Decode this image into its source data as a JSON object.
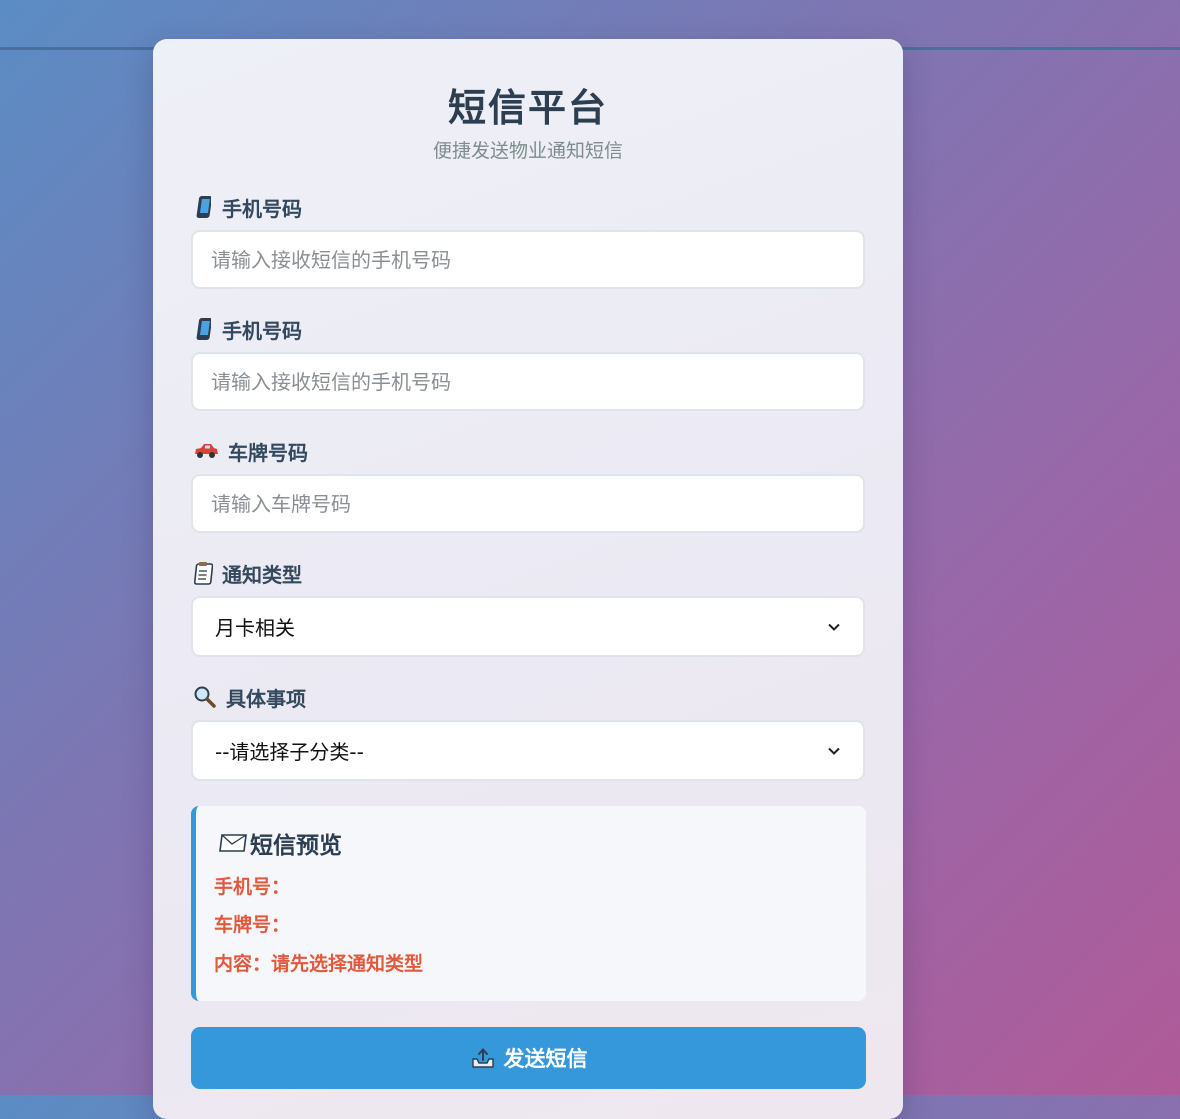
{
  "header": {
    "title": "短信平台",
    "subtitle": "便捷发送物业通知短信"
  },
  "form": {
    "phone1": {
      "label": "手机号码",
      "icon": "mobile-phone-icon",
      "placeholder": "请输入接收短信的手机号码",
      "value": ""
    },
    "phone2": {
      "label": "手机号码",
      "icon": "mobile-phone-icon",
      "placeholder": "请输入接收短信的手机号码",
      "value": ""
    },
    "plate": {
      "label": "车牌号码",
      "icon": "car-icon",
      "placeholder": "请输入车牌号码",
      "value": ""
    },
    "notice_type": {
      "label": "通知类型",
      "icon": "clipboard-icon",
      "selected": "月卡相关"
    },
    "sub_item": {
      "label": "具体事项",
      "icon": "magnifier-icon",
      "selected": "--请选择子分类--"
    }
  },
  "preview": {
    "title": "短信预览",
    "icon": "envelope-icon",
    "phone_line": "手机号：",
    "plate_line": "车牌号：",
    "content_line": "内容：请先选择通知类型"
  },
  "actions": {
    "send_label": "发送短信",
    "send_icon": "outbox-tray-icon"
  },
  "colors": {
    "accent": "#3498db",
    "preview_text": "#e05a3e",
    "title": "#2c3e50"
  }
}
